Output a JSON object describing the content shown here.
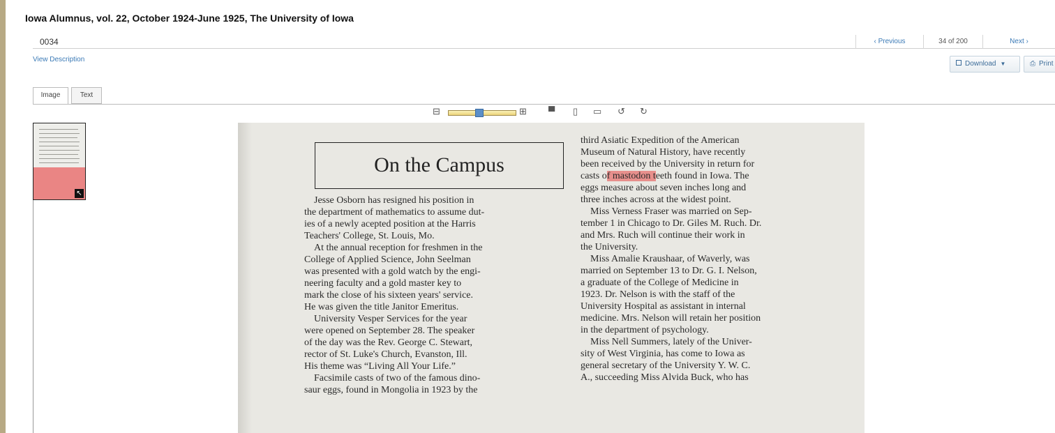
{
  "header": {
    "title": "Iowa Alumnus, vol. 22, October 1924-June 1925, The University of Iowa"
  },
  "record": {
    "id": "0034"
  },
  "nav": {
    "previous": "‹ Previous",
    "count": "34 of 200",
    "next": "Next ›"
  },
  "links": {
    "view_description": "View Description"
  },
  "actions": {
    "download": "Download",
    "print": "Print"
  },
  "tabs": [
    {
      "label": "Image"
    },
    {
      "label": "Text"
    }
  ],
  "toolbar": {
    "zoom_out": "⊟",
    "zoom_in": "⊞",
    "fit_window": "▀",
    "fit_page": "▯",
    "fit_width": "▭",
    "rotate_left": "↺",
    "rotate_right": "↻",
    "zoom_level": 0.45
  },
  "icons": [
    "zoom-out-icon",
    "zoom-in-icon",
    "fit-window-icon",
    "fit-page-icon",
    "fit-width-icon",
    "rotate-left-icon",
    "rotate-right-icon",
    "download-icon",
    "print-icon",
    "expand-icon"
  ],
  "colors": {
    "link": "#3b7ab6",
    "highlight": "#e64646",
    "slider": "#ecd47a"
  },
  "document": {
    "heading": "On the Campus",
    "highlight_term": "f mastodon t",
    "left_lines": [
      "Jesse Osborn has resigned his position in",
      "the department of mathematics to assume dut-",
      "ies of a newly acepted position at the Harris",
      "Teachers' College, St. Louis, Mo.",
      "At the annual reception for freshmen in the",
      "College of Applied Science, John Seelman",
      "was presented with a gold watch by the engi-",
      "neering faculty and a gold master key to",
      "mark the close of his sixteen years' service.",
      "He was given the title Janitor Emeritus.",
      "University Vesper Services for the year",
      "were opened on September 28. The speaker",
      "of the day was the Rev. George C. Stewart,",
      "rector of St. Luke's Church, Evanston, Ill.",
      "His theme was “Living All Your Life.”",
      "Facsimile casts of two of the famous dino-",
      "saur eggs, found in Mongolia in 1923 by the"
    ],
    "right_lines": [
      "third Asiatic Expedition of the American",
      "Museum of Natural History, have recently",
      "been received by the University in return for",
      "casts o",
      "eggs measure about seven inches long and",
      "three inches across at the widest point.",
      "Miss Verness Fraser was married on Sep-",
      "tember 1 in Chicago to Dr. Giles M. Ruch. Dr.",
      "and Mrs. Ruch will continue their work in",
      "the University.",
      "Miss Amalie Kraushaar, of Waverly, was",
      "married on September 13 to Dr. G. I. Nelson,",
      "a graduate of the College of Medicine in",
      "1923. Dr. Nelson is with the staff of the",
      "University Hospital as assistant in internal",
      "medicine. Mrs. Nelson will retain her position",
      "in the department of psychology.",
      "Miss Nell Summers, lately of the Univer-",
      "sity of West Virginia, has come to Iowa as",
      "general secretary of the University Y. W. C.",
      "A., succeeding Miss Alvida Buck, who has"
    ],
    "right_line4_tail": "eeth found in Iowa. The"
  }
}
